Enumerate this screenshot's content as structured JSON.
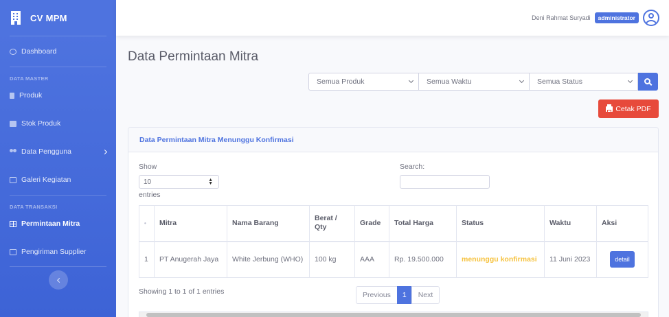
{
  "brand": {
    "name": "CV MPM"
  },
  "sidebar": {
    "dashboard": "Dashboard",
    "heading_master": "DATA MASTER",
    "produk": "Produk",
    "stok_produk": "Stok Produk",
    "data_pengguna": "Data Pengguna",
    "galeri": "Galeri Kegiatan",
    "heading_transaksi": "DATA TRANSAKSI",
    "permintaan": "Permintaan Mitra",
    "pengiriman": "Pengiriman Supplier"
  },
  "topbar": {
    "user_name": "Deni Rahmat Suryadi",
    "role": "administrator"
  },
  "page": {
    "title": "Data Permintaan Mitra"
  },
  "filters": {
    "produk": "Semua Produk",
    "waktu": "Semua Waktu",
    "status": "Semua Status"
  },
  "actions": {
    "cetak_pdf": "Cetak PDF"
  },
  "card": {
    "title": "Data Permintaan Mitra Menunggu Konfirmasi",
    "show_label": "Show",
    "page_length": "10",
    "entries_label": "entries",
    "search_label": "Search:"
  },
  "table": {
    "columns": [
      "Mitra",
      "Nama Barang",
      "Berat / Qty",
      "Grade",
      "Total Harga",
      "Status",
      "Waktu",
      "Aksi"
    ],
    "rows": [
      {
        "no": "1",
        "mitra": "PT Anugerah Jaya",
        "barang": "White Jerbung (WHO)",
        "qty": "100 kg",
        "grade": "AAA",
        "harga": "Rp. 19.500.000",
        "status": "menunggu konfirmasi",
        "waktu": "11 Juni 2023",
        "aksi": "detail"
      }
    ]
  },
  "pagination": {
    "info": "Showing 1 to 1 of 1 entries",
    "previous": "Previous",
    "current": "1",
    "next": "Next"
  },
  "colors": {
    "primary": "#4e73df",
    "danger": "#e74a3b",
    "warning": "#f6c23e"
  }
}
